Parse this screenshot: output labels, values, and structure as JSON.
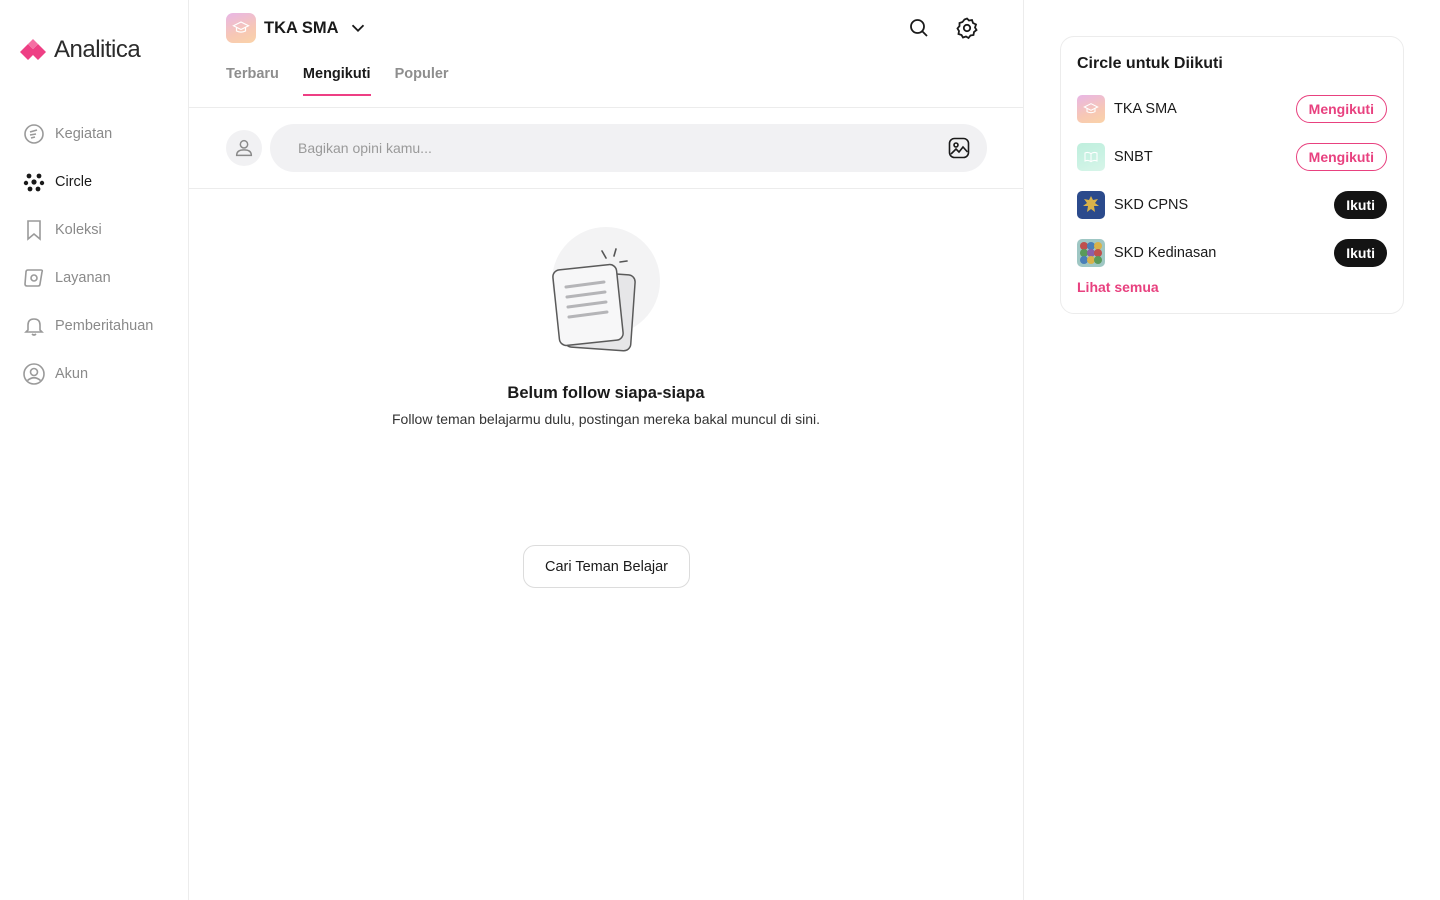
{
  "app": {
    "name": "Analitica",
    "brand_color": "#ee3f84"
  },
  "sidebar": {
    "items": [
      {
        "label": "Kegiatan",
        "icon": "activity-icon",
        "active": false
      },
      {
        "label": "Circle",
        "icon": "circle-dots-icon",
        "active": true
      },
      {
        "label": "Koleksi",
        "icon": "bookmark-icon",
        "active": false
      },
      {
        "label": "Layanan",
        "icon": "service-icon",
        "active": false
      },
      {
        "label": "Pemberitahuan",
        "icon": "bell-icon",
        "active": false
      },
      {
        "label": "Akun",
        "icon": "user-circle-icon",
        "active": false
      }
    ]
  },
  "header": {
    "circle_name": "TKA SMA",
    "icons": [
      "chevron-down-icon",
      "search-icon",
      "gear-icon"
    ]
  },
  "tabs": [
    {
      "label": "Terbaru",
      "active": false
    },
    {
      "label": "Mengikuti",
      "active": true
    },
    {
      "label": "Populer",
      "active": false
    }
  ],
  "composer": {
    "placeholder": "Bagikan opini kamu..."
  },
  "empty_state": {
    "title": "Belum follow siapa-siapa",
    "description": "Follow teman belajarmu dulu, postingan mereka bakal muncul di sini.",
    "button": "Cari Teman Belajar"
  },
  "suggestions": {
    "title": "Circle untuk Diikuti",
    "items": [
      {
        "name": "TKA SMA",
        "action": "Mengikuti",
        "following": true
      },
      {
        "name": "SNBT",
        "action": "Mengikuti",
        "following": true
      },
      {
        "name": "SKD CPNS",
        "action": "Ikuti",
        "following": false
      },
      {
        "name": "SKD Kedinasan",
        "action": "Ikuti",
        "following": false
      }
    ],
    "see_all": "Lihat semua"
  }
}
